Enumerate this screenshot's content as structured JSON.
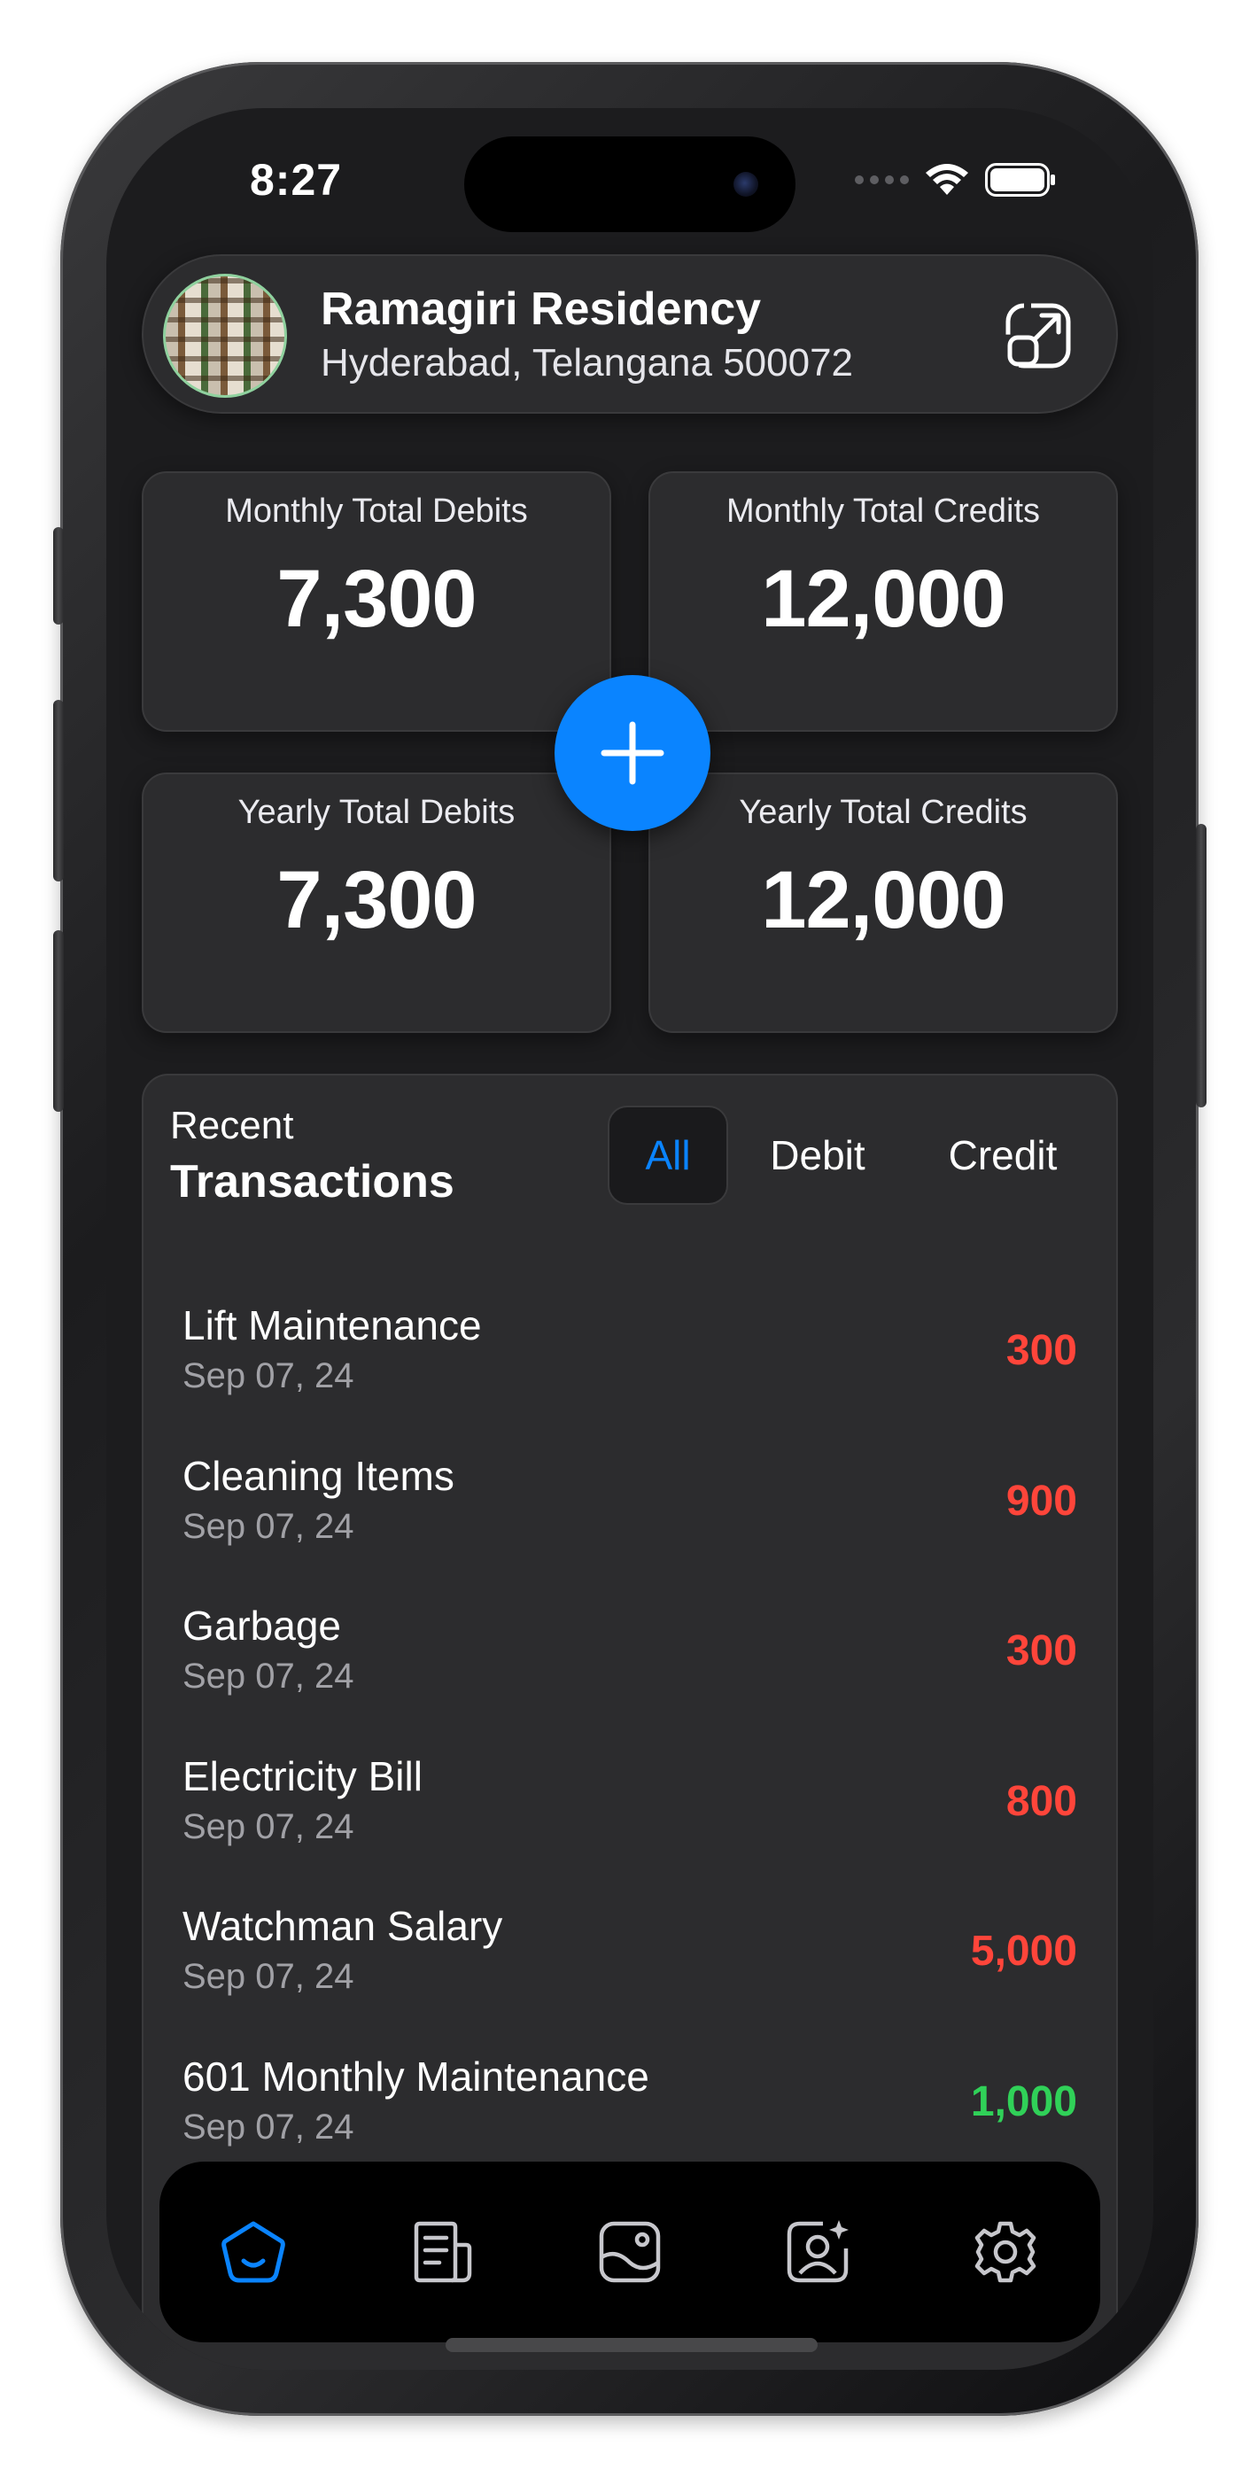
{
  "status_bar": {
    "time": "8:27"
  },
  "header": {
    "title": "Ramagiri Residency",
    "subtitle": "Hyderabad, Telangana 500072",
    "avatar_icon": "building-photo",
    "action_icon": "open-external-icon"
  },
  "stats": {
    "monthly_debits": {
      "label": "Monthly Total Debits",
      "value": "7,300"
    },
    "monthly_credits": {
      "label": "Monthly Total Credits",
      "value": "12,000"
    },
    "yearly_debits": {
      "label": "Yearly Total Debits",
      "value": "7,300"
    },
    "yearly_credits": {
      "label": "Yearly Total Credits",
      "value": "12,000"
    }
  },
  "fab": {
    "icon": "plus-icon"
  },
  "transactions": {
    "heading_small": "Recent",
    "heading_large": "Transactions",
    "filters": [
      "All",
      "Debit",
      "Credit"
    ],
    "active_filter": "All",
    "items": [
      {
        "title": "Lift Maintenance",
        "date": "Sep 07, 24",
        "amount": "300",
        "type": "debit"
      },
      {
        "title": "Cleaning Items",
        "date": "Sep 07, 24",
        "amount": "900",
        "type": "debit"
      },
      {
        "title": "Garbage",
        "date": "Sep 07, 24",
        "amount": "300",
        "type": "debit"
      },
      {
        "title": "Electricity Bill",
        "date": "Sep 07, 24",
        "amount": "800",
        "type": "debit"
      },
      {
        "title": "Watchman Salary",
        "date": "Sep 07, 24",
        "amount": "5,000",
        "type": "debit"
      },
      {
        "title": "601 Monthly Maintenance",
        "date": "Sep 07, 24",
        "amount": "1,000",
        "type": "credit"
      }
    ]
  },
  "tab_bar": {
    "items": [
      "home-icon",
      "ledger-icon",
      "wallet-icon",
      "profile-sparkle-icon",
      "settings-icon"
    ],
    "active_index": 0
  },
  "colors": {
    "accent": "#0a84ff",
    "debit": "#ff453a",
    "credit": "#30d158",
    "background": "#1c1c1e",
    "card": "#2c2c2e"
  }
}
